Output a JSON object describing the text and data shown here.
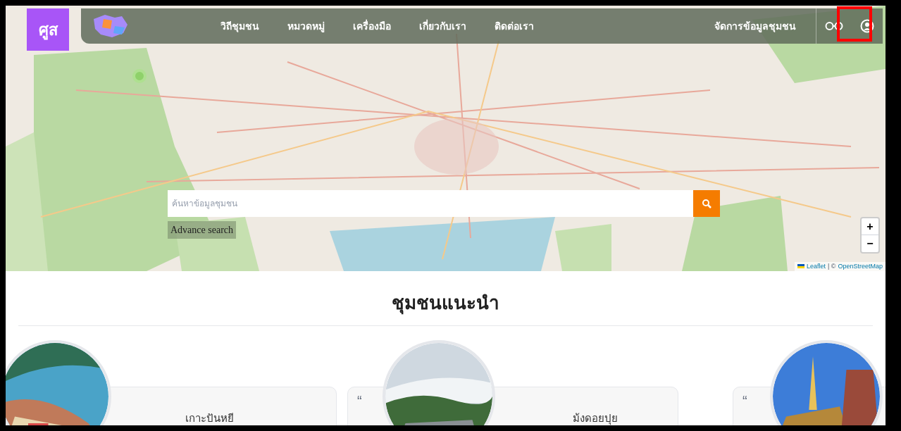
{
  "logo": {
    "text": "ศูส"
  },
  "nav": {
    "items": [
      {
        "label": "วิถีชุมชน"
      },
      {
        "label": "หมวดหมู่"
      },
      {
        "label": "เครื่องมือ"
      },
      {
        "label": "เกี่ยวกับเรา"
      },
      {
        "label": "ติดต่อเรา"
      }
    ],
    "manage": "จัดการข้อมูลชุมชน"
  },
  "search": {
    "placeholder": "ค้นหาข้อมูลชุมชน",
    "advance": "Advance search"
  },
  "map": {
    "zoom_in": "+",
    "zoom_out": "−",
    "attribution_link": "Leaflet",
    "attribution_sep": "| ©",
    "attribution_osm": "OpenStreetMap"
  },
  "section": {
    "title": "ชุมชนแนะนำ"
  },
  "cards": [
    {
      "name": "เกาะปันหยี",
      "kind": "sea"
    },
    {
      "name": "ม้งดอยปุย",
      "kind": "mountain",
      "quote": "“"
    },
    {
      "kind": "temple",
      "quote": "“"
    }
  ]
}
